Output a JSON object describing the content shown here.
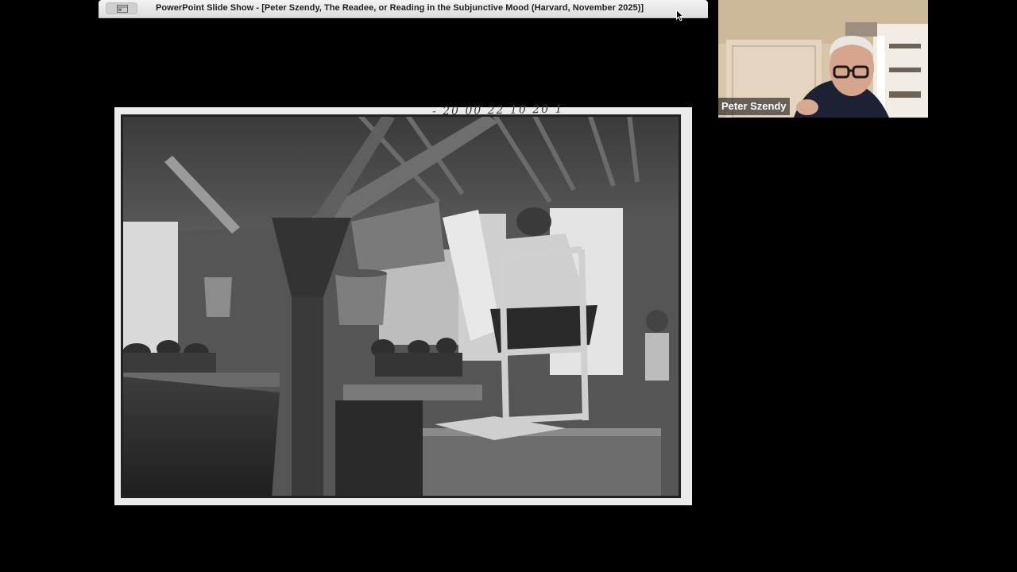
{
  "window": {
    "title": "PowerPoint Slide Show - [Peter Szendy, The Readee, or Reading in the Subjunctive Mood (Harvard, November 2025)]"
  },
  "slide": {
    "handwritten_note": "- 20 00 22 10 20 1"
  },
  "video": {
    "participant_name": "Peter Szendy"
  },
  "icons": {
    "window_button": "window-layout-icon",
    "cursor": "mouse-pointer-icon"
  }
}
